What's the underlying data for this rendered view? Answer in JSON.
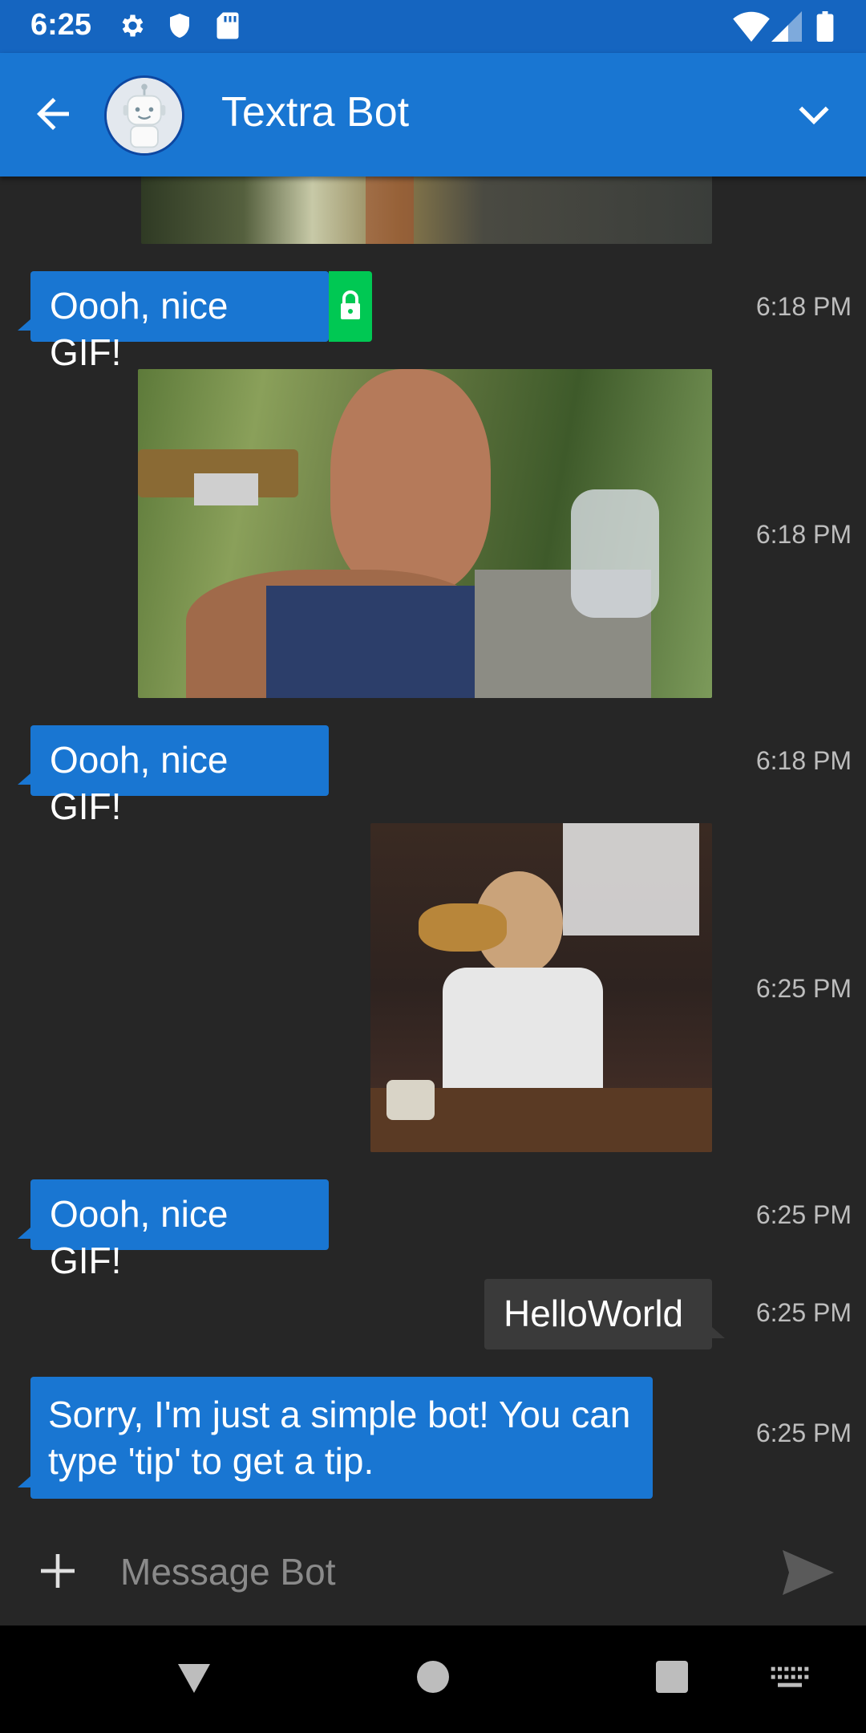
{
  "status_bar": {
    "time": "6:25",
    "left_icons": [
      "gear-icon",
      "shield-icon",
      "sd-card-icon"
    ],
    "right_icons": [
      "wifi-icon",
      "signal-icon",
      "battery-icon"
    ]
  },
  "app_bar": {
    "contact_name": "Textra Bot",
    "colors": {
      "appbar": "#1976d2",
      "statusbar": "#1565c0"
    }
  },
  "messages": [
    {
      "type": "gif",
      "direction": "incoming",
      "description_icon": "gif-image-partial"
    },
    {
      "type": "text",
      "direction": "incoming",
      "text": "Oooh, nice GIF!",
      "time": "6:18 PM",
      "secure": true
    },
    {
      "type": "gif",
      "direction": "outgoing",
      "time": "6:18 PM"
    },
    {
      "type": "text",
      "direction": "incoming",
      "text": "Oooh, nice GIF!",
      "time": "6:18 PM"
    },
    {
      "type": "gif",
      "direction": "outgoing",
      "time": "6:25 PM"
    },
    {
      "type": "text",
      "direction": "incoming",
      "text": "Oooh, nice GIF!",
      "time": "6:25 PM"
    },
    {
      "type": "text",
      "direction": "outgoing",
      "text": "HelloWorld",
      "time": "6:25 PM"
    },
    {
      "type": "text",
      "direction": "incoming",
      "text": "Sorry, I'm just a simple bot! You can type 'tip' to get a tip.",
      "time": "6:25 PM"
    }
  ],
  "composer": {
    "placeholder": "Message Bot"
  },
  "colors": {
    "incoming_bubble": "#1976d2",
    "outgoing_bubble": "#3a3a3a",
    "secure_badge": "#00c853",
    "background": "#262626"
  }
}
